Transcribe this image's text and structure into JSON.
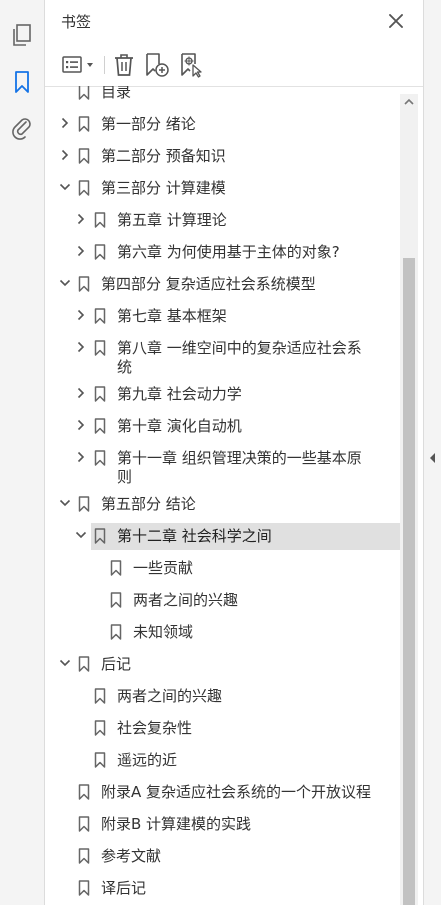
{
  "left_toolbar": {
    "items": [
      {
        "name": "pages-icon"
      },
      {
        "name": "bookmark-icon",
        "active": true
      },
      {
        "name": "attachment-icon"
      }
    ],
    "active_color": "#1473e6"
  },
  "panel": {
    "title": "书签",
    "close_icon": "close-icon",
    "toolbar": [
      "options-menu-icon",
      "delete-icon",
      "new-bookmark-icon",
      "new-bookmark-from-structure-icon"
    ]
  },
  "bookmarks": [
    {
      "label": "目录",
      "level": 0,
      "expander": "none"
    },
    {
      "label": "第一部分   绪论",
      "level": 0,
      "expander": "collapsed"
    },
    {
      "label": "第二部分   预备知识",
      "level": 0,
      "expander": "collapsed"
    },
    {
      "label": "第三部分   计算建模",
      "level": 0,
      "expander": "expanded"
    },
    {
      "label": "第五章   计算理论",
      "level": 1,
      "expander": "collapsed"
    },
    {
      "label": "第六章   为何使用基于主体的对象?",
      "level": 1,
      "expander": "collapsed"
    },
    {
      "label": "第四部分   复杂适应社会系统模型",
      "level": 0,
      "expander": "expanded"
    },
    {
      "label": "第七章   基本框架",
      "level": 1,
      "expander": "collapsed"
    },
    {
      "label": "第八章   一维空间中的复杂适应社会系",
      "label2": "统",
      "level": 1,
      "expander": "collapsed"
    },
    {
      "label": "第九章   社会动力学",
      "level": 1,
      "expander": "collapsed"
    },
    {
      "label": "第十章   演化自动机",
      "level": 1,
      "expander": "collapsed"
    },
    {
      "label": "第十一章   组织管理决策的一些基本原",
      "label2": "则",
      "level": 1,
      "expander": "collapsed"
    },
    {
      "label": "第五部分   结论",
      "level": 0,
      "expander": "expanded"
    },
    {
      "label": "第十二章   社会科学之间",
      "level": 1,
      "expander": "expanded",
      "selected": true
    },
    {
      "label": "一些贡献",
      "level": 2,
      "expander": "none"
    },
    {
      "label": "两者之间的兴趣",
      "level": 2,
      "expander": "none"
    },
    {
      "label": "未知领域",
      "level": 2,
      "expander": "none"
    },
    {
      "label": "后记",
      "level": 0,
      "expander": "expanded"
    },
    {
      "label": "两者之间的兴趣",
      "level": 1,
      "expander": "none"
    },
    {
      "label": "社会复杂性",
      "level": 1,
      "expander": "none"
    },
    {
      "label": "遥远的近",
      "level": 1,
      "expander": "none"
    },
    {
      "label": "附录A   复杂适应社会系统的一个开放议程",
      "level": 0,
      "expander": "none"
    },
    {
      "label": "附录B   计算建模的实践",
      "level": 0,
      "expander": "none"
    },
    {
      "label": "参考文献",
      "level": 0,
      "expander": "none"
    },
    {
      "label": "译后记",
      "level": 0,
      "expander": "none"
    }
  ]
}
